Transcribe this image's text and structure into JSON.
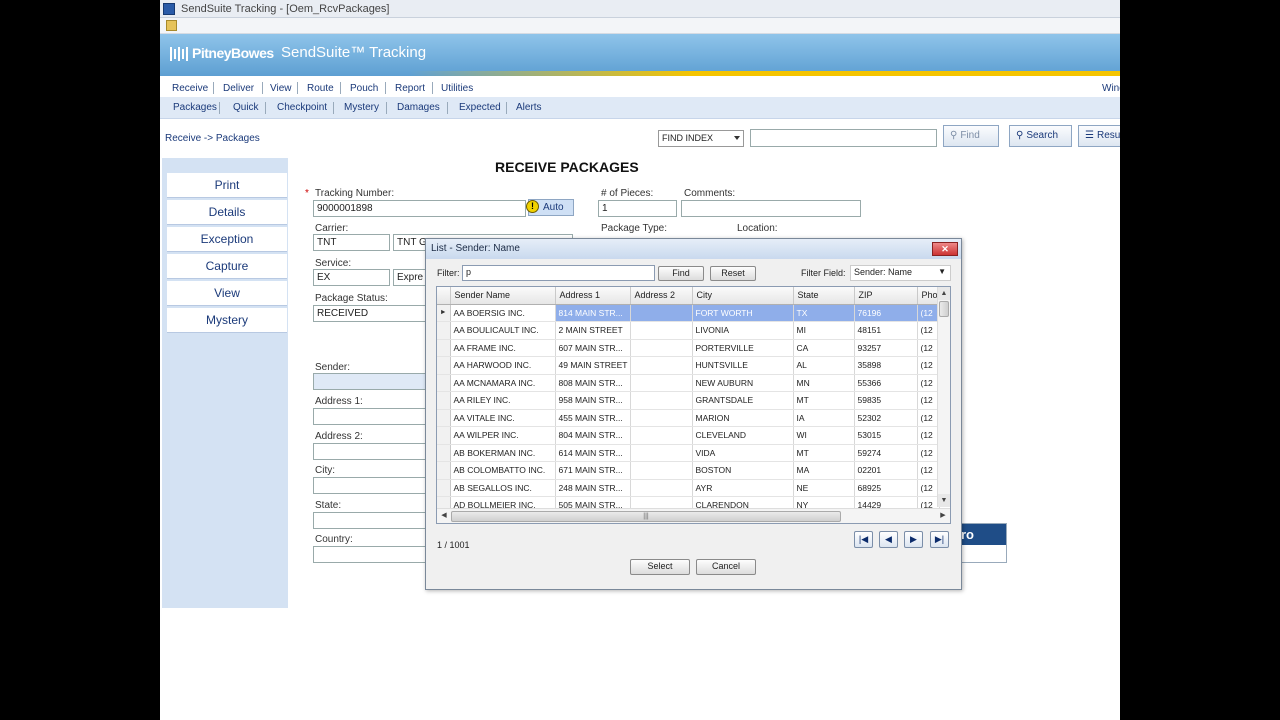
{
  "window": {
    "title": "SendSuite Tracking - [Oem_RcvPackages]"
  },
  "banner": {
    "brand": "PitneyBowes",
    "product": "SendSuite™ Tracking"
  },
  "menu_main": [
    "Receive",
    "Deliver",
    "View",
    "Route",
    "Pouch",
    "Report",
    "Utilities"
  ],
  "menu_right": "Wind",
  "menu_sub": [
    "Packages",
    "Quick",
    "Checkpoint",
    "Mystery",
    "Damages",
    "Expected",
    "Alerts"
  ],
  "breadcrumb": "Receive -> Packages",
  "search": {
    "index_value": "FIND INDEX",
    "query": "",
    "find_label": "Find",
    "search_label": "Search",
    "results_label": "Resu"
  },
  "sidebar": [
    "Print",
    "Details",
    "Exception",
    "Capture",
    "View",
    "Mystery"
  ],
  "form": {
    "heading": "RECEIVE PACKAGES",
    "tracking_label": "Tracking Number:",
    "tracking_required": "*",
    "tracking_value": "9000001898",
    "auto_label": "Auto",
    "pieces_label": "# of Pieces:",
    "pieces_value": "1",
    "comments_label": "Comments:",
    "comments_value": "",
    "carrier_label": "Carrier:",
    "carrier_code": "TNT",
    "carrier_name": "TNT G",
    "package_type_label": "Package Type:",
    "location_label": "Location:",
    "service_label": "Service:",
    "service_code": "EX",
    "service_name": "Expre",
    "status_label": "Package Status:",
    "status_value": "RECEIVED",
    "sender_label": "Sender:",
    "address1_label": "Address 1:",
    "address2_label": "Address 2:",
    "city_label": "City:",
    "state_label": "State:",
    "country_label": "Country:",
    "side_panel_header": "ro"
  },
  "dialog": {
    "title": "List - Sender: Name",
    "filter_label": "Filter:",
    "filter_value": "p",
    "find_label": "Find",
    "reset_label": "Reset",
    "filter_field_label": "Filter Field:",
    "filter_field_value": "Sender: Name",
    "columns": [
      "Sender Name",
      "Address 1",
      "Address 2",
      "City",
      "State",
      "ZIP",
      "Pho"
    ],
    "rows": [
      [
        "AA BOERSIG INC.",
        "814 MAIN STR...",
        "",
        "FORT WORTH",
        "TX",
        "76196",
        "(12"
      ],
      [
        "AA BOULICAULT INC.",
        "2 MAIN STREET",
        "",
        "LIVONIA",
        "MI",
        "48151",
        "(12"
      ],
      [
        "AA FRAME INC.",
        "607 MAIN STR...",
        "",
        "PORTERVILLE",
        "CA",
        "93257",
        "(12"
      ],
      [
        "AA HARWOOD INC.",
        "49 MAIN STREET",
        "",
        "HUNTSVILLE",
        "AL",
        "35898",
        "(12"
      ],
      [
        "AA MCNAMARA INC.",
        "808 MAIN STR...",
        "",
        "NEW AUBURN",
        "MN",
        "55366",
        "(12"
      ],
      [
        "AA RILEY INC.",
        "958 MAIN STR...",
        "",
        "GRANTSDALE",
        "MT",
        "59835",
        "(12"
      ],
      [
        "AA VITALE INC.",
        "455 MAIN STR...",
        "",
        "MARION",
        "IA",
        "52302",
        "(12"
      ],
      [
        "AA WILPER INC.",
        "804 MAIN STR...",
        "",
        "CLEVELAND",
        "WI",
        "53015",
        "(12"
      ],
      [
        "AB BOKERMAN INC.",
        "614 MAIN STR...",
        "",
        "VIDA",
        "MT",
        "59274",
        "(12"
      ],
      [
        "AB COLOMBATTO INC.",
        "671 MAIN STR...",
        "",
        "BOSTON",
        "MA",
        "02201",
        "(12"
      ],
      [
        "AB SEGALLOS INC.",
        "248 MAIN STR...",
        "",
        "AYR",
        "NE",
        "68925",
        "(12"
      ],
      [
        "AD BOLLMEIER INC.",
        "505 MAIN STR...",
        "",
        "CLARENDON",
        "NY",
        "14429",
        "(12"
      ]
    ],
    "pager": "1 / 1001",
    "select_label": "Select",
    "cancel_label": "Cancel"
  },
  "colors": {
    "accent": "#1f4d87",
    "banner": "#6aaad9",
    "selection": "#8faeea",
    "swoosh": "#f5c400"
  }
}
